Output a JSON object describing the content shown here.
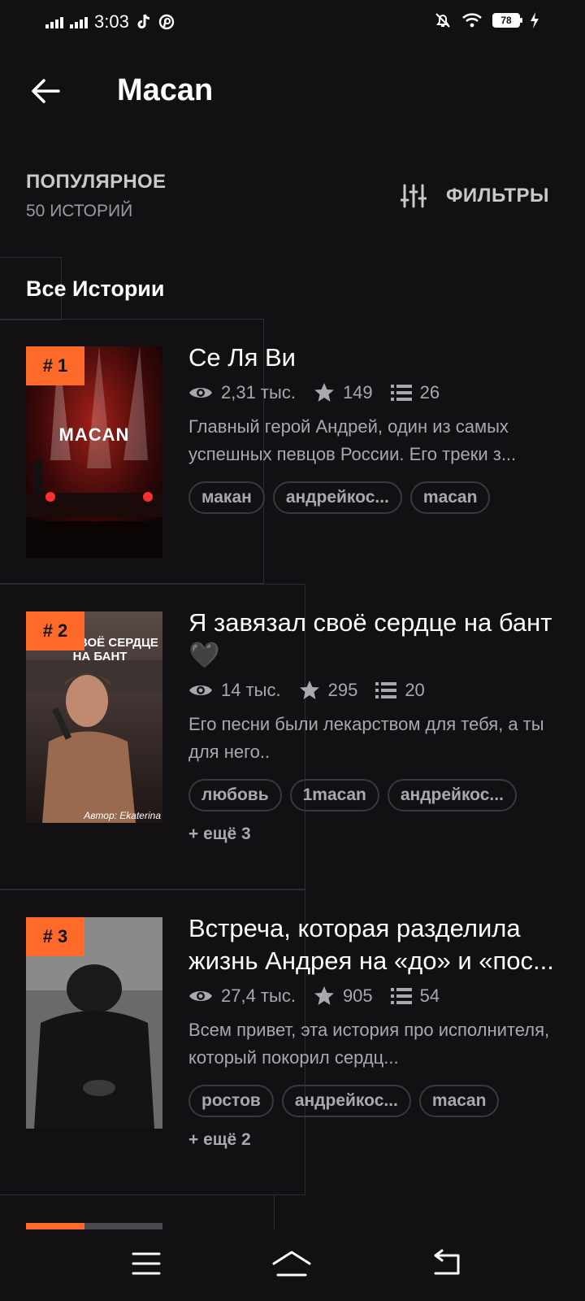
{
  "status_bar": {
    "time": "3:03",
    "battery": "78"
  },
  "header": {
    "title": "Macan"
  },
  "section": {
    "title": "ПОПУЛЯРНОЕ",
    "count": "50 ИСТОРИЙ",
    "filters_label": "ФИЛЬТРЫ"
  },
  "tab": {
    "label": "Все Истории"
  },
  "stories": [
    {
      "rank": "# 1",
      "title": "Се Ля Ви",
      "views": "2,31 тыс.",
      "votes": "149",
      "parts": "26",
      "desc": "Главный герой Андрей, один из самых успешных певцов России. Его треки з...",
      "tags": [
        "макан",
        "андрейкос...",
        "macan"
      ],
      "cover_text": "MACAN"
    },
    {
      "rank": "# 2",
      "title": "Я завязал своё сердце на бант🖤",
      "views": "14 тыс.",
      "votes": "295",
      "parts": "20",
      "desc": "Его песни были лекарством для тебя, а ты для него..",
      "tags": [
        "любовь",
        "1macan",
        "андрейкос..."
      ],
      "more": "+ ещё 3",
      "cover_text": "ЗАЛ СВОЁ СЕРДЦЕ НА БАНТ",
      "cover_author": "Автор: Ekaterina"
    },
    {
      "rank": "# 3",
      "title": "Встреча, которая разделила жизнь Андрея на «до» и «пос...",
      "views": "27,4 тыс.",
      "votes": "905",
      "parts": "54",
      "desc": "Всем привет, эта история про исполнителя, который покорил сердц...",
      "tags": [
        "ростов",
        "андрейкос...",
        "macan"
      ],
      "more": "+ ещё 2"
    }
  ]
}
